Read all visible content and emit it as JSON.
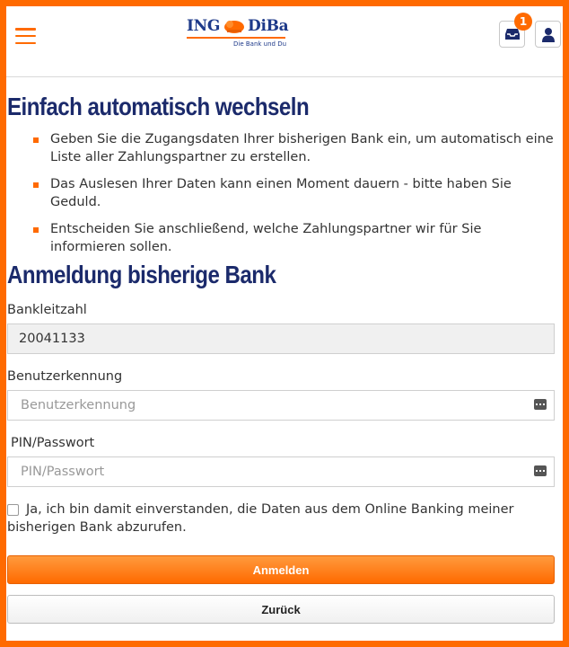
{
  "header": {
    "logo_left": "ING",
    "logo_right": "DiBa",
    "logo_tagline": "Die Bank und Du",
    "inbox_badge": "1"
  },
  "intro": {
    "title": "Einfach automatisch wechseln",
    "bullets": [
      "Geben Sie die Zugangsdaten Ihrer bisherigen Bank ein, um automatisch eine Liste aller Zahlungspartner zu erstellen.",
      "Das Auslesen Ihrer Daten kann einen Moment dauern - bitte haben Sie Geduld.",
      "Entscheiden Sie anschließend, welche Zahlungspartner wir für Sie informieren sollen."
    ]
  },
  "login": {
    "title": "Anmeldung bisherige Bank",
    "blz_label": "Bankleitzahl",
    "blz_value": "20041133",
    "user_label": "Benutzerkennung",
    "user_placeholder": "Benutzerkennung",
    "pin_label": "PIN/Passwort",
    "pin_placeholder": "PIN/Passwort",
    "consent_text": "Ja, ich bin damit einverstanden, die Daten aus dem Online Banking meiner bisherigen Bank abzurufen.",
    "submit_label": "Anmelden",
    "back_label": "Zurück"
  },
  "icons": {
    "menu": "hamburger-menu-icon",
    "inbox": "inbox-icon",
    "user": "user-icon",
    "keyboard": "keyboard-icon",
    "bullet": "bullet-square-icon"
  },
  "colors": {
    "accent": "#ff6a00",
    "heading": "#1b2a6b",
    "logo": "#1e3a8a"
  }
}
